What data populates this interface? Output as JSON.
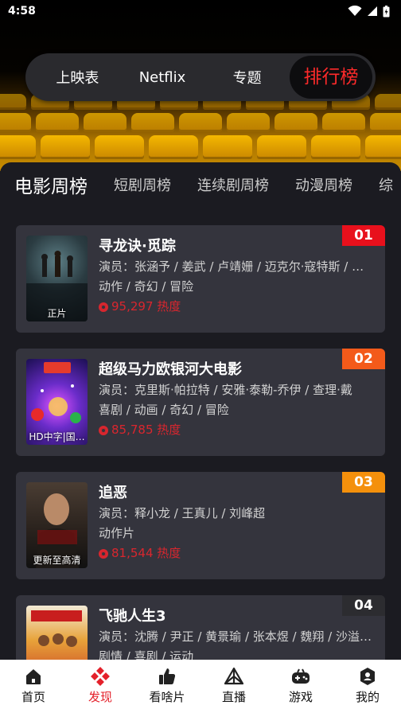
{
  "status": {
    "time": "4:58"
  },
  "top_tabs": [
    {
      "label": "上映表",
      "active": false
    },
    {
      "label": "Netflix",
      "active": false
    },
    {
      "label": "专题",
      "active": false
    },
    {
      "label": "排行榜",
      "active": true
    }
  ],
  "sub_tabs": [
    {
      "label": "电影周榜",
      "active": true
    },
    {
      "label": "短剧周榜",
      "active": false
    },
    {
      "label": "连续剧周榜",
      "active": false
    },
    {
      "label": "动漫周榜",
      "active": false
    },
    {
      "label": "综",
      "active": false
    }
  ],
  "rankings": [
    {
      "rank": "01",
      "rank_color": "#e8101c",
      "title": "寻龙诀·觅踪",
      "cast": "演员：张涵予 / 姜武 / 卢靖姗 / 迈克尔·寇特斯 / …",
      "genres": "动作 / 奇幻 / 冒险",
      "heat": "95,297 热度",
      "poster_tag": "正片"
    },
    {
      "rank": "02",
      "rank_color": "#f35a1a",
      "title": "超级马力欧银河大电影",
      "cast": "演员：克里斯·帕拉特 / 安雅·泰勒-乔伊 / 查理·戴",
      "genres": "喜剧 / 动画 / 奇幻 / 冒险",
      "heat": "85,785 热度",
      "poster_tag": "HD中字|国…"
    },
    {
      "rank": "03",
      "rank_color": "#f4900c",
      "title": "追恶",
      "cast": "演员：释小龙 / 王真儿 / 刘峰超",
      "genres": "动作片",
      "heat": "81,544 热度",
      "poster_tag": "更新至高清"
    },
    {
      "rank": "04",
      "rank_color": "#2c2c30",
      "title": "飞驰人生3",
      "cast": "演员：沈腾 / 尹正 / 黄景瑜 / 张本煜 / 魏翔 / 沙溢…",
      "genres": "剧情 / 喜剧 / 运动",
      "heat": "",
      "poster_tag": ""
    }
  ],
  "bottom_nav": [
    {
      "label": "首页",
      "icon": "home-icon",
      "active": false
    },
    {
      "label": "发现",
      "icon": "discover-icon",
      "active": true
    },
    {
      "label": "看啥片",
      "icon": "thumbs-up-icon",
      "active": false
    },
    {
      "label": "直播",
      "icon": "live-icon",
      "active": false
    },
    {
      "label": "游戏",
      "icon": "gamepad-icon",
      "active": false
    },
    {
      "label": "我的",
      "icon": "profile-icon",
      "active": false
    }
  ],
  "colors": {
    "accent": "#e4202a",
    "card": "#34343d",
    "background": "#1b1b21"
  }
}
